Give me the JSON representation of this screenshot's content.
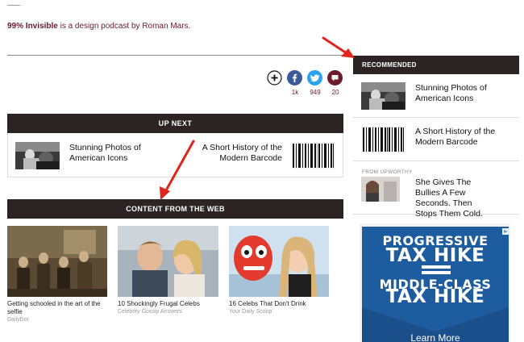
{
  "podcast": {
    "brand": "99% Invisible",
    "tagline": " is a design podcast by Roman Mars."
  },
  "share": {
    "counts": [
      "1k",
      "949",
      "20"
    ]
  },
  "up_next": {
    "header": "UP NEXT",
    "left_title": "Stunning Photos of American Icons",
    "right_title": "A Short History of the Modern Barcode"
  },
  "web": {
    "header": "CONTENT FROM THE WEB",
    "cards": [
      {
        "title": "Getting schooled in the art of the selfie",
        "source": "DailyDot"
      },
      {
        "title": "10 Shockingly Frugal Celebs",
        "source": "Celebrity Gossip Answers"
      },
      {
        "title": "16 Celebs That Don't Drink",
        "source": "Your Daily Scoop"
      }
    ]
  },
  "recommended": {
    "header": "RECOMMENDED",
    "items": [
      {
        "title": "Stunning Photos of American Icons"
      },
      {
        "title": "A Short History of the Modern Barcode"
      },
      {
        "label": "FROM UPWORTHY",
        "title": "She Gives The Bullies A Few Seconds. Then Stops Them Cold."
      }
    ]
  },
  "ad": {
    "line1": "PROGRESSIVE",
    "line2": "TAX HIKE",
    "line3": "MIDDLE-CLASS",
    "line4": "TAX HIKE",
    "cta": "Learn More"
  },
  "colors": {
    "header_bg": "#2b2324",
    "accent": "#6b1a2e",
    "facebook": "#3b5998",
    "twitter": "#2aa3ef",
    "comment": "#6b1a2e",
    "ad_blue": "#1e5ca0",
    "arrow_red": "#e0261c"
  }
}
